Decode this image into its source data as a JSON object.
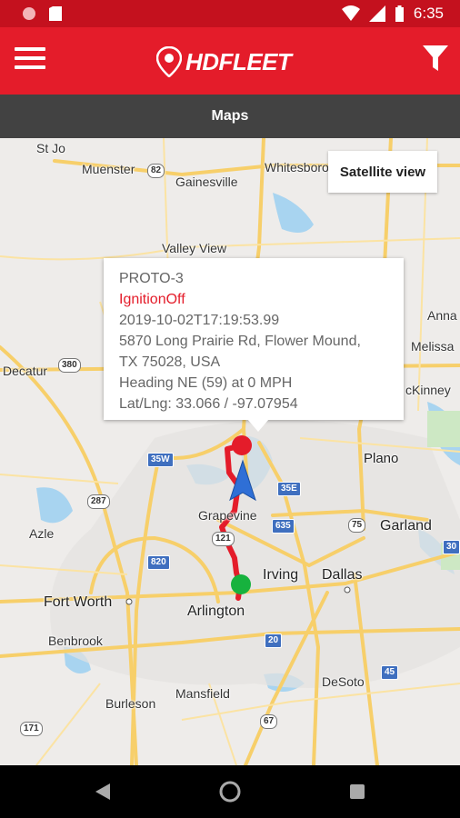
{
  "status_bar": {
    "time": "6:35",
    "icons": [
      "record-icon",
      "sim-card-icon",
      "wifi-icon",
      "signal-icon",
      "battery-icon"
    ]
  },
  "app_bar": {
    "logo_text": "HDFLEET",
    "icons": [
      "menu-icon",
      "location-pin-icon",
      "filter-icon"
    ],
    "brand_color": "#e41c2a"
  },
  "title_bar": {
    "title": "Maps"
  },
  "map": {
    "satellite_button": "Satellite view",
    "places": {
      "st_jo": "St Jo",
      "muenster": "Muenster",
      "whitesboro": "Whitesboro",
      "gainesville": "Gainesville",
      "valley_view": "Valley View",
      "anna": "Anna",
      "melissa": "Melissa",
      "decatur": "Decatur",
      "mckinney": "cKinney",
      "plano": "Plano",
      "grapevine": "Grapevine",
      "garland": "Garland",
      "azle": "Azle",
      "irving": "Irving",
      "dallas": "Dallas",
      "fort_worth": "Fort Worth",
      "arlington": "Arlington",
      "benbrook": "Benbrook",
      "desoto": "DeSoto",
      "mansfield": "Mansfield",
      "burleson": "Burleson"
    },
    "shields": {
      "s82": "82",
      "s380": "380",
      "i35w": "35W",
      "s287": "287",
      "i35e": "35E",
      "i635": "635",
      "s75": "75",
      "s121": "121",
      "i820": "820",
      "i30": "30",
      "s20": "20",
      "i45": "45",
      "s67": "67",
      "s171": "171"
    },
    "popup": {
      "device": "PROTO-3",
      "status": "IgnitionOff",
      "timestamp": "2019-10-02T17:19:53.99",
      "address_line1": "5870 Long Prairie Rd, Flower Mound,",
      "address_line2": "TX 75028, USA",
      "heading": "Heading NE (59) at 0 MPH",
      "latlng": "Lat/Lng: 33.066 / -97.07954"
    },
    "route_color": "#e41c2a",
    "start_marker_color": "#17b23e",
    "end_marker_color": "#e41c2a",
    "heading_arrow_color": "#2f6fd6"
  },
  "nav_bar": {
    "icons": [
      "back-icon",
      "home-icon",
      "recents-icon"
    ]
  }
}
